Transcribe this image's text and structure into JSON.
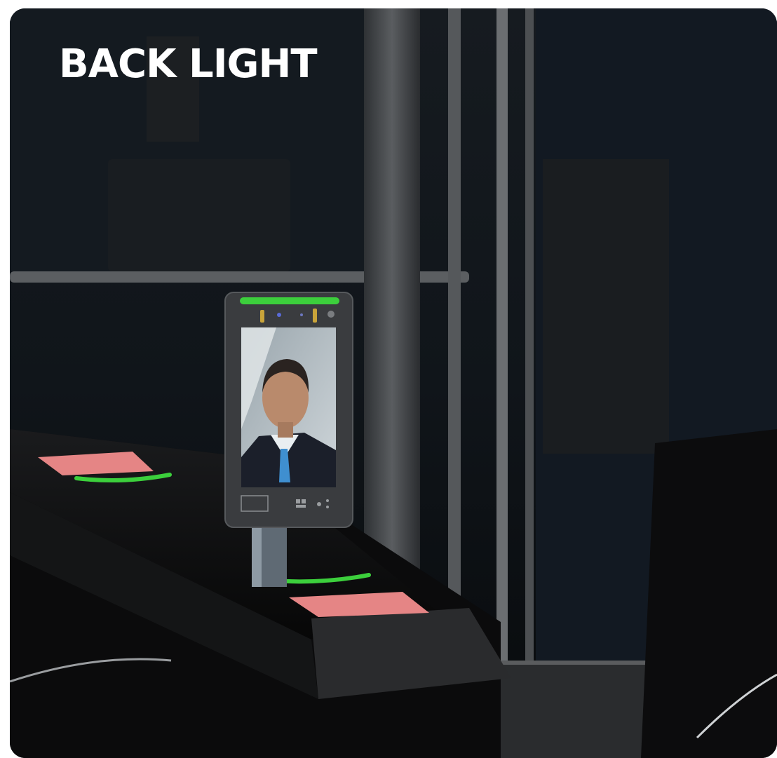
{
  "headline": "BACK LIGHT",
  "scene": {
    "subject": "face-recognition-terminal",
    "colors": {
      "background": "#0f1317",
      "glass": "#121820",
      "frame": "#4a4d50",
      "gate": "#0a0a0a",
      "indicator_green": "#3ccf3c",
      "card_reader": "#e58585",
      "headline": "#ffffff"
    }
  }
}
